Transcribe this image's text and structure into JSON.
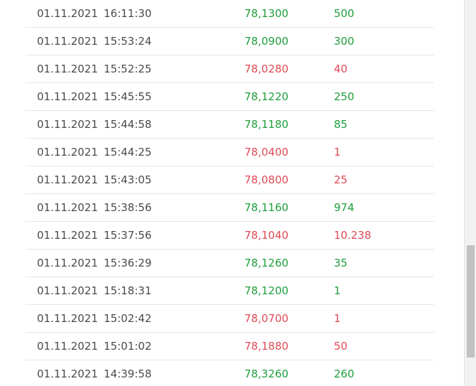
{
  "trades": [
    {
      "date": "01.11.2021",
      "time": "16:11:30",
      "price": "78,1300",
      "volume": "500",
      "direction": "up"
    },
    {
      "date": "01.11.2021",
      "time": "15:53:24",
      "price": "78,0900",
      "volume": "300",
      "direction": "up"
    },
    {
      "date": "01.11.2021",
      "time": "15:52:25",
      "price": "78,0280",
      "volume": "40",
      "direction": "down"
    },
    {
      "date": "01.11.2021",
      "time": "15:45:55",
      "price": "78,1220",
      "volume": "250",
      "direction": "up"
    },
    {
      "date": "01.11.2021",
      "time": "15:44:58",
      "price": "78,1180",
      "volume": "85",
      "direction": "up"
    },
    {
      "date": "01.11.2021",
      "time": "15:44:25",
      "price": "78,0400",
      "volume": "1",
      "direction": "down"
    },
    {
      "date": "01.11.2021",
      "time": "15:43:05",
      "price": "78,0800",
      "volume": "25",
      "direction": "down"
    },
    {
      "date": "01.11.2021",
      "time": "15:38:56",
      "price": "78,1160",
      "volume": "974",
      "direction": "up"
    },
    {
      "date": "01.11.2021",
      "time": "15:37:56",
      "price": "78,1040",
      "volume": "10.238",
      "direction": "down"
    },
    {
      "date": "01.11.2021",
      "time": "15:36:29",
      "price": "78,1260",
      "volume": "35",
      "direction": "up"
    },
    {
      "date": "01.11.2021",
      "time": "15:18:31",
      "price": "78,1200",
      "volume": "1",
      "direction": "up"
    },
    {
      "date": "01.11.2021",
      "time": "15:02:42",
      "price": "78,0700",
      "volume": "1",
      "direction": "down"
    },
    {
      "date": "01.11.2021",
      "time": "15:01:02",
      "price": "78,1880",
      "volume": "50",
      "direction": "down"
    },
    {
      "date": "01.11.2021",
      "time": "14:39:58",
      "price": "78,3260",
      "volume": "260",
      "direction": "up"
    }
  ],
  "colors": {
    "up": "#1e9e3c",
    "down": "#e04a55",
    "text": "#4a4a4a"
  }
}
